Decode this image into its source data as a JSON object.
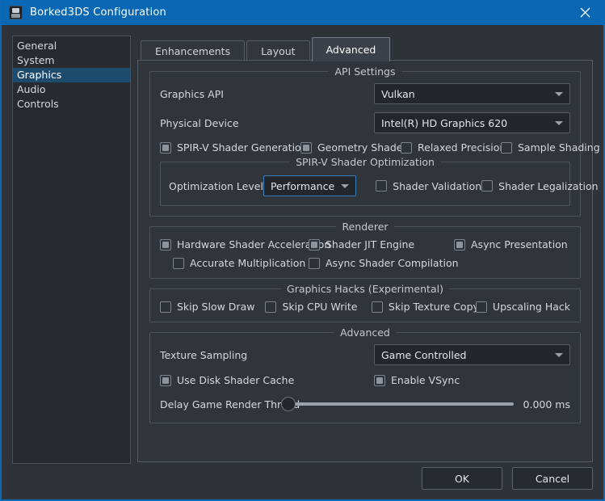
{
  "window": {
    "title": "Borked3DS Configuration",
    "icon": "app-icon",
    "close_label": "×"
  },
  "sidebar": {
    "items": [
      {
        "label": "General",
        "selected": false
      },
      {
        "label": "System",
        "selected": false
      },
      {
        "label": "Graphics",
        "selected": true
      },
      {
        "label": "Audio",
        "selected": false
      },
      {
        "label": "Controls",
        "selected": false
      }
    ]
  },
  "tabs": [
    {
      "label": "Enhancements",
      "active": false
    },
    {
      "label": "Layout",
      "active": false
    },
    {
      "label": "Advanced",
      "active": true
    }
  ],
  "api_settings": {
    "legend": "API Settings",
    "graphics_api": {
      "label": "Graphics API",
      "value": "Vulkan"
    },
    "physical_device": {
      "label": "Physical Device",
      "value": "Intel(R) HD Graphics 620"
    },
    "checkboxes": [
      {
        "label": "SPIR-V Shader Generatio",
        "checked": true
      },
      {
        "label": "Geometry Shader",
        "checked": true
      },
      {
        "label": "Relaxed Precision",
        "checked": false
      },
      {
        "label": "Sample Shading",
        "checked": false
      }
    ],
    "optimization": {
      "legend": "SPIR-V Shader Optimization",
      "level_label": "Optimization Level",
      "level_value": "Performance",
      "checkboxes": [
        {
          "label": "Shader Validation",
          "checked": false
        },
        {
          "label": "Shader Legalization",
          "checked": false
        }
      ]
    }
  },
  "renderer": {
    "legend": "Renderer",
    "row1": [
      {
        "label": "Hardware Shader Acceleration",
        "checked": true
      },
      {
        "label": "Shader JIT Engine",
        "checked": true
      },
      {
        "label": "Async Presentation",
        "checked": true
      }
    ],
    "row2": [
      {
        "label": "Accurate Multiplication",
        "checked": false
      },
      {
        "label": "Async Shader Compilation",
        "checked": false
      }
    ]
  },
  "graphics_hacks": {
    "legend": "Graphics Hacks (Experimental)",
    "checkboxes": [
      {
        "label": "Skip Slow Draw",
        "checked": false
      },
      {
        "label": "Skip CPU Write",
        "checked": false
      },
      {
        "label": "Skip Texture Copy",
        "checked": false
      },
      {
        "label": "Upscaling Hack",
        "checked": false
      }
    ]
  },
  "advanced": {
    "legend": "Advanced",
    "texture_sampling": {
      "label": "Texture Sampling",
      "value": "Game Controlled"
    },
    "checkboxes": [
      {
        "label": "Use Disk Shader Cache",
        "checked": true
      },
      {
        "label": "Enable VSync",
        "checked": true
      }
    ],
    "delay_slider": {
      "label": "Delay Game Render Thread",
      "value": "0.000 ms",
      "percent": 0
    }
  },
  "footer": {
    "ok_label": "OK",
    "cancel_label": "Cancel"
  },
  "colors": {
    "titlebar": "#0a67b3",
    "window_bg": "#2e3338",
    "panel_bg": "#30353b",
    "selection": "#1d4b6e",
    "focus_border": "#3d7fb8"
  }
}
